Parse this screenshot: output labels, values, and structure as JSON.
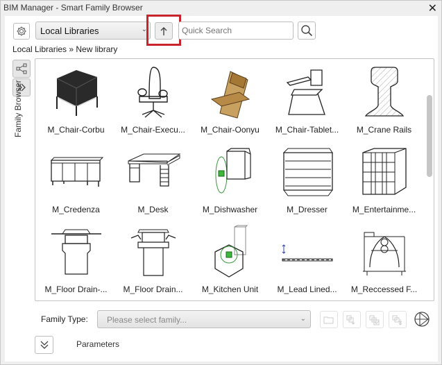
{
  "window": {
    "title": "BIM Manager - Smart Family Browser",
    "close_icon": "close-icon"
  },
  "toolbar": {
    "settings_icon": "gear-icon",
    "library_select": {
      "selected": "Local Libraries"
    },
    "up_icon": "arrow-up-icon",
    "search": {
      "value": "",
      "placeholder": "Quick Search"
    },
    "search_icon": "magnifier-icon"
  },
  "breadcrumb": "Local Libraries » New library",
  "sidebar": {
    "share_icon": "share-nodes-icon",
    "expand_icon": "double-chevron-right-icon",
    "label": "Family Browser"
  },
  "families": [
    {
      "label": "M_Chair-Corbu",
      "icon": "chair-corbu"
    },
    {
      "label": "M_Chair-Execu...",
      "icon": "chair-executive"
    },
    {
      "label": "M_Chair-Oonyu",
      "icon": "chair-oonyu"
    },
    {
      "label": "M_Chair-Tablet...",
      "icon": "chair-tablet"
    },
    {
      "label": "M_Crane Rails",
      "icon": "crane-rail"
    },
    {
      "label": "M_Credenza",
      "icon": "credenza"
    },
    {
      "label": "M_Desk",
      "icon": "desk"
    },
    {
      "label": "M_Dishwasher",
      "icon": "dishwasher"
    },
    {
      "label": "M_Dresser",
      "icon": "dresser"
    },
    {
      "label": "M_Entertainme...",
      "icon": "entertainment"
    },
    {
      "label": "M_Floor Drain-...",
      "icon": "floor-drain-a"
    },
    {
      "label": "M_Floor Drain...",
      "icon": "floor-drain-b"
    },
    {
      "label": "M_Kitchen Unit",
      "icon": "kitchen-unit"
    },
    {
      "label": "M_Lead Lined...",
      "icon": "lead-lined"
    },
    {
      "label": "M_Reccessed F...",
      "icon": "recessed-fixture"
    }
  ],
  "family_type": {
    "label": "Family Type:",
    "placeholder": "Please select family..."
  },
  "actions": {
    "open_icon": "folder-open-icon",
    "load_icon": "folder-load-icon",
    "load_checked_icon": "folder-check-icon",
    "load_all_icon": "folder-download-icon",
    "logo_icon": "globe-logo-icon"
  },
  "parameters": {
    "label": "Parameters"
  },
  "colors": {
    "highlight": "#c8242c",
    "panel": "#ffffff",
    "chrome": "#efefef"
  }
}
